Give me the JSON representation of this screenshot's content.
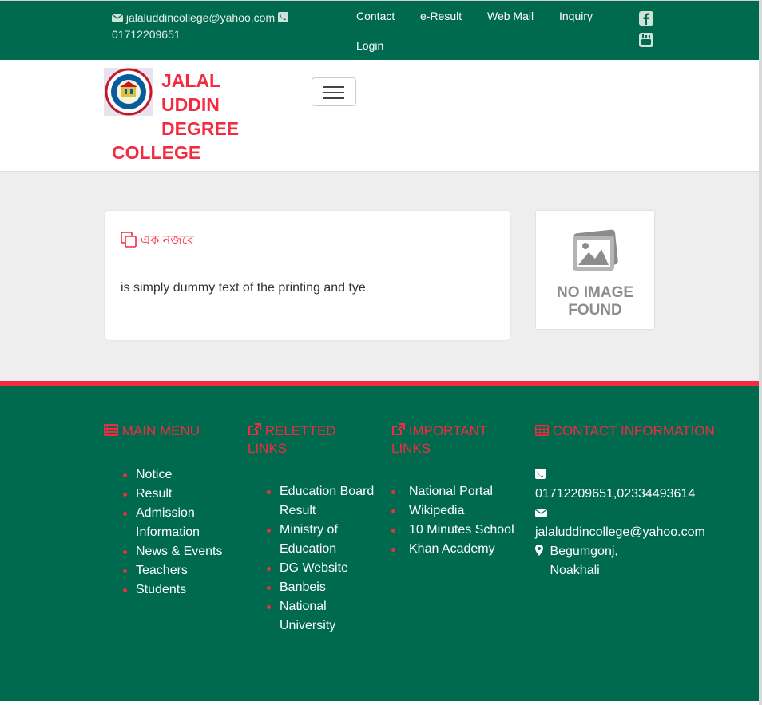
{
  "topbar": {
    "email": "jalaluddincollege@yahoo.com",
    "phone": "01712209651",
    "nav": [
      "Contact",
      "e-Result",
      "Web Mail",
      "Inquiry",
      "Login"
    ],
    "social": [
      "facebook-icon",
      "youtube-icon"
    ],
    "colors": {
      "background": "#006a4e",
      "text": "#ffffff"
    }
  },
  "header": {
    "brand_line1": "JALAL",
    "brand_line2": "UDDIN",
    "brand_line3": "DEGREE",
    "brand_line4": "COLLEGE",
    "brand_color": "#f42a41",
    "menu_toggle_icon": "hamburger-icon"
  },
  "main": {
    "card": {
      "title": "এক নজরে",
      "title_icon": "clone-icon",
      "text": "is simply dummy text of the printing and tye"
    },
    "placeholder_image": {
      "line1": "NO IMAGE",
      "line2": "FOUND"
    }
  },
  "footer": {
    "colors": {
      "background": "#006a4e",
      "accent": "#f42a41"
    },
    "main_menu": {
      "title": "MAIN MENU",
      "items": [
        "Notice",
        "Result",
        "Admission Information",
        "News & Events",
        "Teachers",
        "Students"
      ]
    },
    "related_links": {
      "title": "RELETTED LINKS",
      "items": [
        "Education Board Result",
        "Ministry of Education",
        "DG Website",
        "Banbeis",
        "National University"
      ]
    },
    "important_links": {
      "title": "IMPORTANT LINKS",
      "items": [
        "National Portal",
        "Wikipedia",
        "10 Minutes School",
        "Khan Academy"
      ]
    },
    "contact": {
      "title": "CONTACT INFORMATION",
      "phone": "01712209651,02334493614",
      "email": "jalaluddincollege@yahoo.com",
      "address": "Begumgonj, Noakhali"
    }
  }
}
